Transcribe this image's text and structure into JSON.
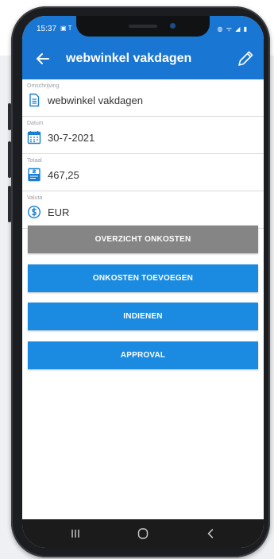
{
  "status_bar": {
    "time": "15:37",
    "left_icons": "▣ T",
    "right_icons": "◍ ᯤ ◢ ▮"
  },
  "app_bar": {
    "title": "webwinkel vakdagen"
  },
  "fields": [
    {
      "label": "Omschrijving",
      "value": "webwinkel vakdagen",
      "icon": "document-icon"
    },
    {
      "label": "Datum",
      "value": "30-7-2021",
      "icon": "calendar-icon"
    },
    {
      "label": "Totaal",
      "value": "467,25",
      "icon": "receipt-icon"
    },
    {
      "label": "Valuta",
      "value": "EUR",
      "icon": "dollar-icon"
    }
  ],
  "buttons": {
    "overview": "OVERZICHT ONKOSTEN",
    "add": "ONKOSTEN TOEVOEGEN",
    "submit": "INDIENEN",
    "approval": "APPROVAL"
  },
  "colors": {
    "primary": "#1976d2",
    "button_blue": "#1a8be0",
    "button_grey": "#858585",
    "field_icon": "#1a7fd4"
  }
}
